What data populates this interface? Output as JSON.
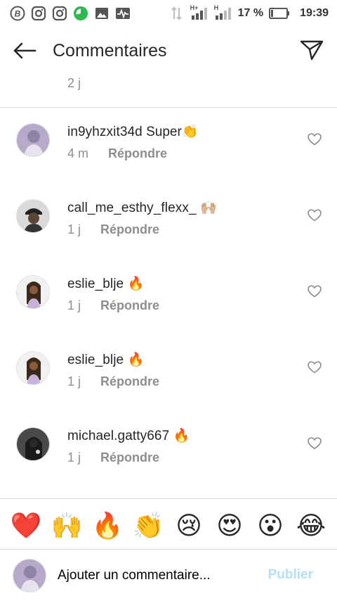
{
  "status_bar": {
    "icons": [
      "b-circle-icon",
      "instagram-icon",
      "instagram-icon",
      "download-progress-icon",
      "image-icon",
      "activity-icon"
    ],
    "network_icons": [
      "data-transfer-icon",
      "signal-hplus-icon",
      "signal-h-icon"
    ],
    "network_labels": [
      "H+",
      "H"
    ],
    "battery_percent": "17 %",
    "time": "19:39"
  },
  "header": {
    "title": "Commentaires"
  },
  "previous": {
    "time": "2 j"
  },
  "comments": [
    {
      "username": "in9yhzxit34d",
      "text": "Super",
      "emoji": "👏",
      "time": "4 m",
      "reply": "Répondre"
    },
    {
      "username": "call_me_esthy_flexx_",
      "text": "",
      "emoji": "🙌🏼",
      "time": "1 j",
      "reply": "Répondre"
    },
    {
      "username": "eslie_blje",
      "text": "",
      "emoji": "🔥",
      "time": "1 j",
      "reply": "Répondre"
    },
    {
      "username": "eslie_blje",
      "text": "",
      "emoji": "🔥",
      "time": "1 j",
      "reply": "Répondre"
    },
    {
      "username": "michael.gatty667",
      "text": "",
      "emoji": "🔥",
      "time": "1 j",
      "reply": "Répondre"
    }
  ],
  "emoji_bar": [
    "❤️",
    "🙌",
    "🔥",
    "👏",
    "😢",
    "😍",
    "😮",
    "😂"
  ],
  "input": {
    "placeholder": "Ajouter un commentaire...",
    "publish_label": "Publier"
  },
  "colors": {
    "secondary_text": "#8e8e8e",
    "divider": "#dbdbdb",
    "publish_disabled": "#b2dffc"
  }
}
